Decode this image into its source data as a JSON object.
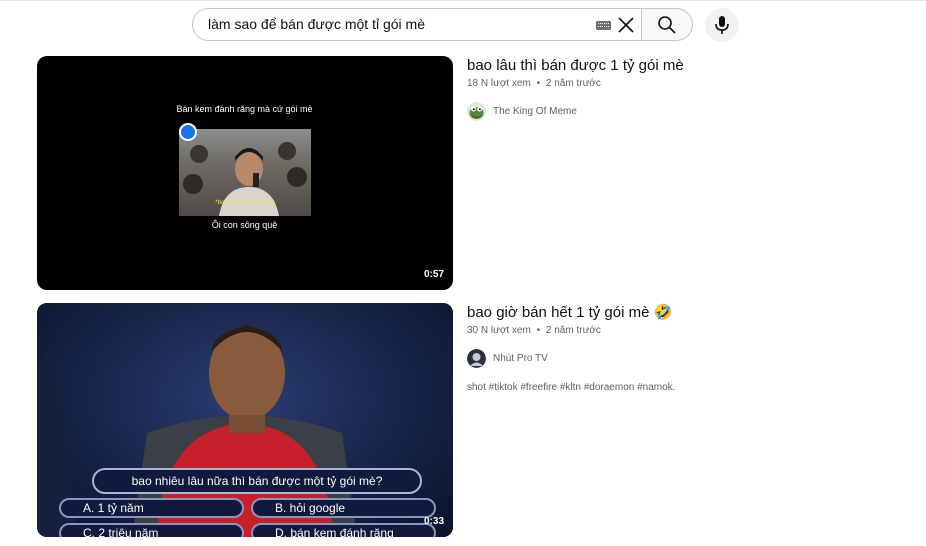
{
  "search": {
    "query": "làm sao để bán được một tỉ gói mè"
  },
  "results": [
    {
      "title": "bao lâu thì bán được 1 tỷ gói mè",
      "views": "18 N lượt xem",
      "age": "2 năm trước",
      "channel": "The King Of Meme",
      "duration": "0:57",
      "thumb_caption_top": "Bán kem đánh răng mà cứ gói mè",
      "thumb_caption_sub": "*bao có bán mè ở đâu",
      "thumb_caption_bottom": "Ôi con sông quê"
    },
    {
      "title": "bao giờ bán hết 1 tỷ gói mè 🤣",
      "views": "30 N lượt xem",
      "age": "2 năm trước",
      "channel": "Nhút Pro TV",
      "description": "shot #tiktok #freefire #kltn #doraemon #namok.",
      "duration": "0:33",
      "thumb_question": "bao nhiêu lâu nữa thì bán được một tỷ gói mè?",
      "thumb_answers": [
        "A. 1 tỷ năm",
        "B. hỏi google",
        "C. 2 triệu năm",
        "D. bán kem đánh răng"
      ]
    }
  ],
  "meta_separator": "•",
  "colors": {
    "accent": "#065fd4",
    "text": "#0f0f0f",
    "secondary": "#606060"
  }
}
